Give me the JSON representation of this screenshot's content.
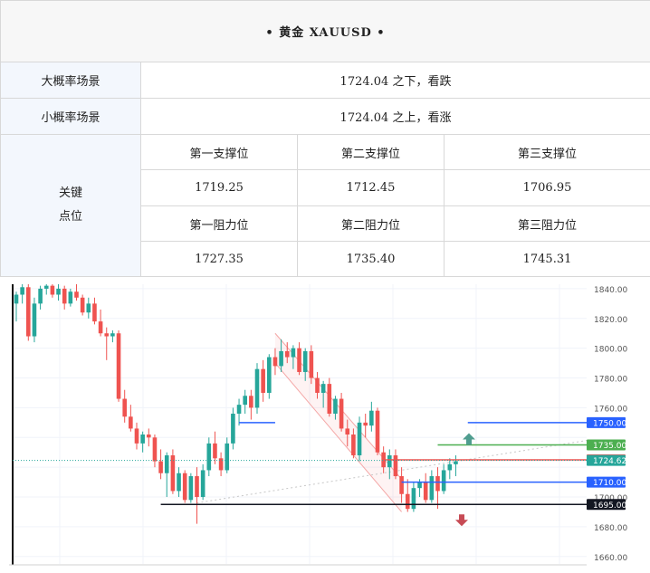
{
  "header": {
    "title": "•  黄金 XAUUSD  •"
  },
  "scenarios": {
    "big_label": "大概率场景",
    "big_value": "1724.04 之下，看跌",
    "small_label": "小概率场景",
    "small_value": "1724.04 之上，看涨"
  },
  "key_levels": {
    "label_line1": "关键",
    "label_line2": "点位",
    "support_headers": [
      "第一支撑位",
      "第二支撑位",
      "第三支撑位"
    ],
    "support_values": [
      "1719.25",
      "1712.45",
      "1706.95"
    ],
    "resistance_headers": [
      "第一阻力位",
      "第二阻力位",
      "第三阻力位"
    ],
    "resistance_values": [
      "1727.35",
      "1735.40",
      "1745.31"
    ]
  },
  "chart_data": {
    "type": "candlestick",
    "instrument": "XAUUSD",
    "ylim": [
      1655,
      1843
    ],
    "y_ticks": [
      "1840.00",
      "1820.00",
      "1800.00",
      "1780.00",
      "1760.00",
      "1700.00",
      "1680.00",
      "1660.00"
    ],
    "y_tick_values": [
      1840,
      1820,
      1800,
      1780,
      1760,
      1700,
      1680,
      1660
    ],
    "grid": true,
    "candles": [
      [
        1830,
        1838,
        1818,
        1836
      ],
      [
        1836,
        1843,
        1830,
        1841
      ],
      [
        1841,
        1843,
        1805,
        1808
      ],
      [
        1808,
        1834,
        1804,
        1830
      ],
      [
        1830,
        1842,
        1826,
        1840
      ],
      [
        1840,
        1843,
        1836,
        1842
      ],
      [
        1842,
        1843,
        1834,
        1836
      ],
      [
        1836,
        1843,
        1832,
        1840
      ],
      [
        1840,
        1842,
        1826,
        1830
      ],
      [
        1830,
        1840,
        1828,
        1838
      ],
      [
        1838,
        1843,
        1832,
        1834
      ],
      [
        1834,
        1836,
        1822,
        1824
      ],
      [
        1824,
        1834,
        1820,
        1830
      ],
      [
        1830,
        1834,
        1816,
        1818
      ],
      [
        1818,
        1826,
        1808,
        1810
      ],
      [
        1810,
        1814,
        1792,
        1808
      ],
      [
        1808,
        1812,
        1804,
        1810
      ],
      [
        1810,
        1812,
        1764,
        1766
      ],
      [
        1766,
        1772,
        1750,
        1754
      ],
      [
        1754,
        1762,
        1744,
        1746
      ],
      [
        1746,
        1750,
        1732,
        1736
      ],
      [
        1736,
        1744,
        1730,
        1742
      ],
      [
        1742,
        1746,
        1734,
        1740
      ],
      [
        1740,
        1742,
        1720,
        1724
      ],
      [
        1724,
        1732,
        1712,
        1716
      ],
      [
        1716,
        1730,
        1700,
        1728
      ],
      [
        1728,
        1732,
        1702,
        1704
      ],
      [
        1704,
        1720,
        1700,
        1716
      ],
      [
        1716,
        1718,
        1696,
        1698
      ],
      [
        1698,
        1716,
        1696,
        1714
      ],
      [
        1714,
        1720,
        1682,
        1700
      ],
      [
        1700,
        1722,
        1698,
        1718
      ],
      [
        1718,
        1740,
        1714,
        1736
      ],
      [
        1736,
        1744,
        1722,
        1726
      ],
      [
        1726,
        1730,
        1714,
        1718
      ],
      [
        1718,
        1740,
        1716,
        1736
      ],
      [
        1736,
        1760,
        1732,
        1756
      ],
      [
        1756,
        1766,
        1748,
        1762
      ],
      [
        1762,
        1772,
        1756,
        1768
      ],
      [
        1768,
        1772,
        1752,
        1760
      ],
      [
        1760,
        1790,
        1756,
        1786
      ],
      [
        1786,
        1792,
        1764,
        1770
      ],
      [
        1770,
        1796,
        1766,
        1794
      ],
      [
        1794,
        1800,
        1782,
        1788
      ],
      [
        1788,
        1806,
        1784,
        1798
      ],
      [
        1798,
        1804,
        1790,
        1794
      ],
      [
        1794,
        1802,
        1786,
        1800
      ],
      [
        1800,
        1804,
        1782,
        1784
      ],
      [
        1784,
        1800,
        1778,
        1798
      ],
      [
        1798,
        1802,
        1776,
        1780
      ],
      [
        1780,
        1784,
        1766,
        1770
      ],
      [
        1770,
        1778,
        1760,
        1776
      ],
      [
        1776,
        1780,
        1754,
        1756
      ],
      [
        1756,
        1768,
        1752,
        1766
      ],
      [
        1766,
        1770,
        1744,
        1746
      ],
      [
        1746,
        1752,
        1734,
        1742
      ],
      [
        1742,
        1746,
        1726,
        1728
      ],
      [
        1728,
        1754,
        1724,
        1750
      ],
      [
        1750,
        1756,
        1740,
        1748
      ],
      [
        1748,
        1764,
        1744,
        1758
      ],
      [
        1758,
        1760,
        1728,
        1730
      ],
      [
        1730,
        1734,
        1716,
        1720
      ],
      [
        1720,
        1732,
        1712,
        1728
      ],
      [
        1728,
        1732,
        1712,
        1714
      ],
      [
        1714,
        1720,
        1696,
        1702
      ],
      [
        1702,
        1712,
        1690,
        1692
      ],
      [
        1692,
        1710,
        1690,
        1706
      ],
      [
        1706,
        1712,
        1700,
        1710
      ],
      [
        1710,
        1716,
        1696,
        1698
      ],
      [
        1698,
        1718,
        1696,
        1714
      ],
      [
        1714,
        1720,
        1692,
        1704
      ],
      [
        1704,
        1722,
        1702,
        1718
      ],
      [
        1718,
        1726,
        1712,
        1722
      ],
      [
        1722,
        1728,
        1714,
        1724
      ]
    ],
    "levels": [
      {
        "label": "1750.00",
        "value": 1750,
        "color": "#2962ff",
        "style": "solid"
      },
      {
        "label": "1735.00",
        "value": 1735,
        "color": "#4caf50",
        "style": "solid"
      },
      {
        "label": "1725.00",
        "value": 1725,
        "color": "#ef5350",
        "style": "solid"
      },
      {
        "label": "1724.62",
        "value": 1724.62,
        "color": "#26a69a",
        "style": "dotted"
      },
      {
        "label": "1710.00",
        "value": 1710,
        "color": "#2962ff",
        "style": "solid"
      },
      {
        "label": "1695.00",
        "value": 1695,
        "color": "#131722",
        "style": "solid"
      }
    ],
    "colors": {
      "up": "#26a69a",
      "down": "#ef5350",
      "grid": "#f0f3fa",
      "axis_text": "#555555"
    }
  }
}
